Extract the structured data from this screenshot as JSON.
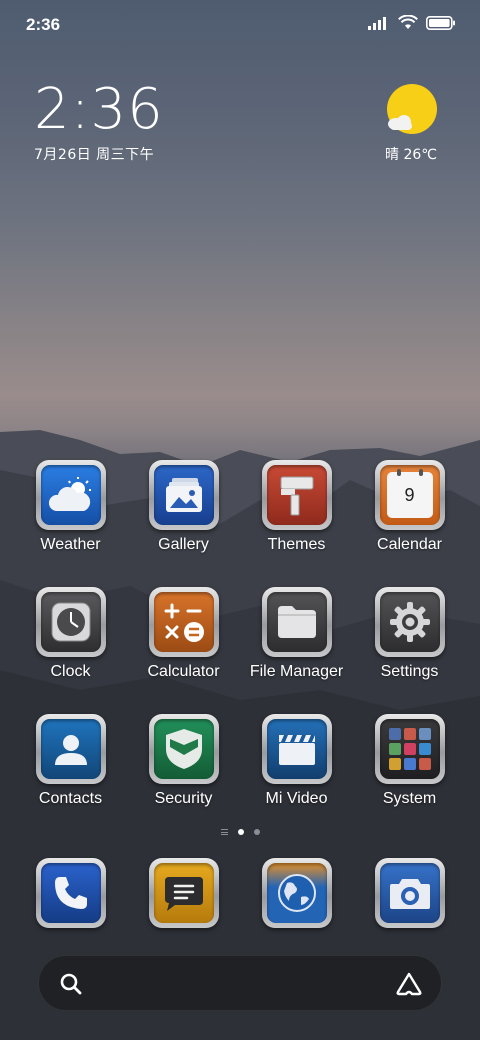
{
  "status_bar": {
    "time": "2:36",
    "icons": [
      "signal-icon",
      "wifi-icon",
      "battery-icon"
    ]
  },
  "clock_widget": {
    "time": "2:36",
    "date": "7月26日 周三下午"
  },
  "weather_widget": {
    "condition": "晴",
    "temperature": "26℃",
    "icon": "sun-cloud-icon",
    "sun_color": "#f7cf16"
  },
  "apps": [
    {
      "label": "Weather",
      "icon": "weather-icon",
      "color": "#1a5fc0"
    },
    {
      "label": "Gallery",
      "icon": "gallery-icon",
      "color": "#1d4ea8"
    },
    {
      "label": "Themes",
      "icon": "themes-icon",
      "color": "#b33a2a"
    },
    {
      "label": "Calendar",
      "icon": "calendar-icon",
      "color": "#d9762b",
      "calendar_day": "9"
    },
    {
      "label": "Clock",
      "icon": "clock-icon",
      "color": "#3a3a3c"
    },
    {
      "label": "Calculator",
      "icon": "calculator-icon",
      "color": "#c9641c"
    },
    {
      "label": "File Manager",
      "icon": "folder-icon",
      "color": "#3c3c3e"
    },
    {
      "label": "Settings",
      "icon": "gear-icon",
      "color": "#3c3c3e"
    },
    {
      "label": "Contacts",
      "icon": "contacts-icon",
      "color": "#1b63a5"
    },
    {
      "label": "Security",
      "icon": "shield-icon",
      "color": "#1f7a48"
    },
    {
      "label": "Mi Video",
      "icon": "video-icon",
      "color": "#1c5a9c"
    },
    {
      "label": "System",
      "icon": "folder-grid-icon",
      "color": "#2a2a2c"
    }
  ],
  "dock": [
    {
      "icon": "phone-icon",
      "color": "#1b4fb0"
    },
    {
      "icon": "messages-icon",
      "color": "#d99a16"
    },
    {
      "icon": "browser-icon",
      "color": "#1e64b8"
    },
    {
      "icon": "camera-icon",
      "color": "#2a60b5"
    }
  ],
  "page_indicator": {
    "pages": 2,
    "active": 1
  },
  "search_bar": {
    "icon": "search-icon",
    "assistant_icon": "assistant-icon"
  }
}
